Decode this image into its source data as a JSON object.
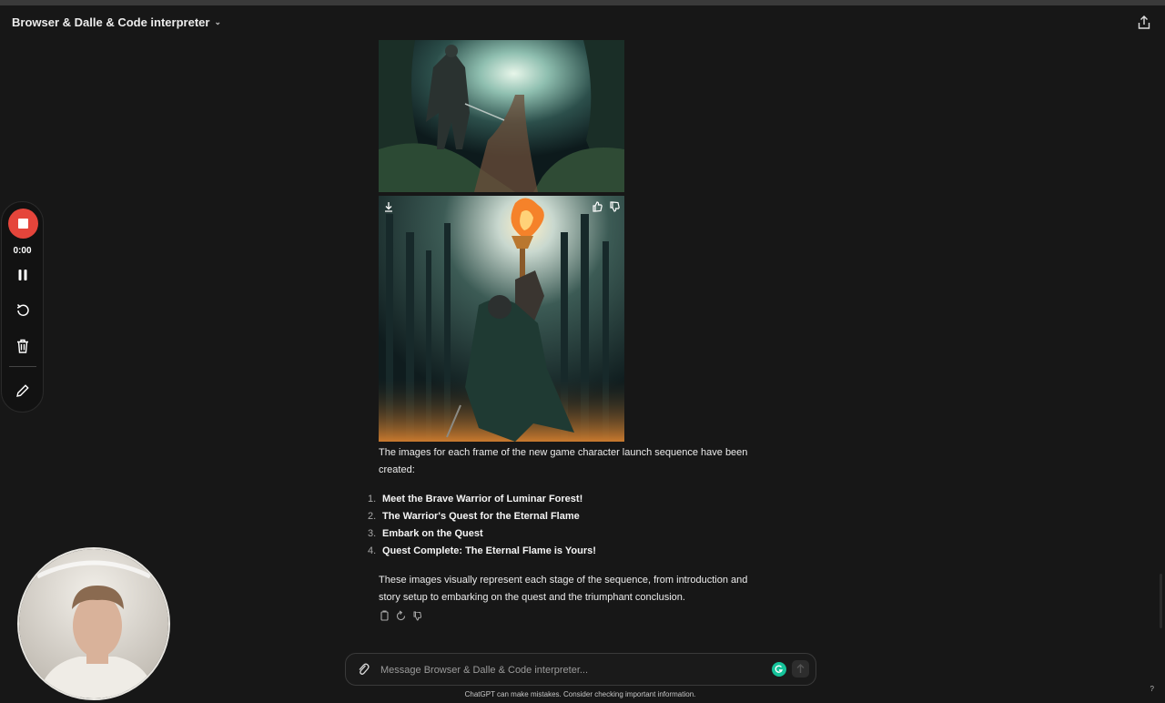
{
  "header": {
    "title": "Browser & Dalle & Code interpreter",
    "title_icon": "chevron-down-icon",
    "share_icon": "share-icon"
  },
  "images": [
    {
      "name": "warrior-forest-path"
    },
    {
      "name": "warrior-raising-flame",
      "actions": [
        "download-icon",
        "thumbs-up-icon",
        "thumbs-down-icon"
      ]
    }
  ],
  "message": {
    "intro": "The images for each frame of the new game character launch sequence have been created:",
    "items": [
      {
        "num": "1.",
        "text": "Meet the Brave Warrior of Luminar Forest!"
      },
      {
        "num": "2.",
        "text": "The Warrior's Quest for the Eternal Flame"
      },
      {
        "num": "3.",
        "text": "Embark on the Quest"
      },
      {
        "num": "4.",
        "text": "Quest Complete: The Eternal Flame is Yours!"
      }
    ],
    "outro": "These images visually represent each stage of the sequence, from introduction and story setup to embarking on the quest and the triumphant conclusion.",
    "actions": [
      "copy-icon",
      "regenerate-icon",
      "thumbs-down-icon"
    ]
  },
  "composer": {
    "placeholder": "Message Browser & Dalle & Code interpreter...",
    "value": ""
  },
  "disclaimer": "ChatGPT can make mistakes. Consider checking important information.",
  "help": "?",
  "recorder": {
    "time": "0:00"
  },
  "colors": {
    "background": "#171717",
    "record": "#e5453b",
    "grammarly": "#15c39a"
  }
}
